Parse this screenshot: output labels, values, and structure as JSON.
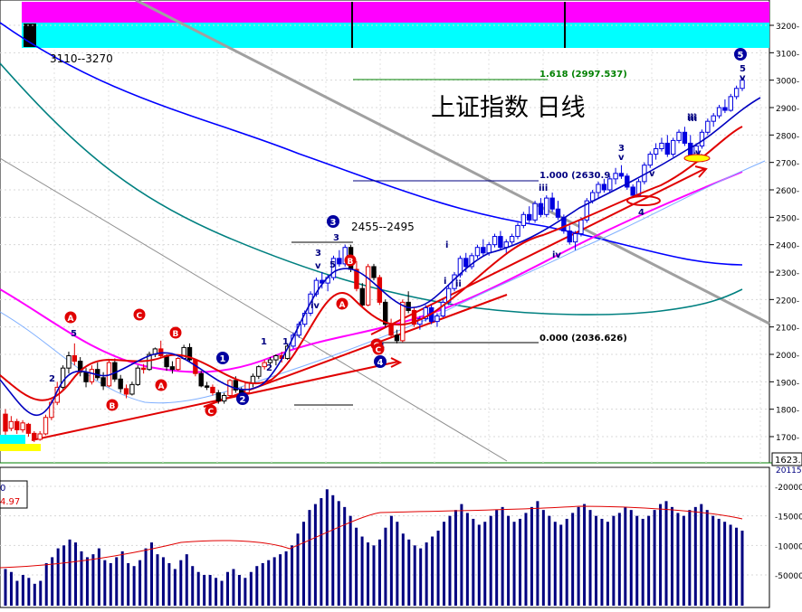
{
  "chart_data": {
    "type": "candlestick",
    "title": "上证指数  日线",
    "range_note_left": "3110--3270",
    "range_note_mid": "2455--2495",
    "fib_levels": [
      {
        "ratio": "1.618",
        "label": "1.618 (2997.537)",
        "value": 2997.537
      },
      {
        "ratio": "1.000",
        "label": "1.000 (2630.9",
        "value": 2630.9
      },
      {
        "ratio": "0.000",
        "label": "0.000 (2036.626)",
        "value": 2036.626
      }
    ],
    "y_axis": {
      "ticks": [
        "3200",
        "3100",
        "3000",
        "2900",
        "2800",
        "2700",
        "2600",
        "2500",
        "2400",
        "2300",
        "2200",
        "2100",
        "2000",
        "1900",
        "1800",
        "1700"
      ],
      "current_price_tag": "1623."
    },
    "volume_axis": {
      "ticks": [
        "200000",
        "150000",
        "100000",
        "50000"
      ],
      "top_tag": "201150"
    },
    "legend_fragments": [
      "0",
      "4.97"
    ],
    "wave_labels_black": [
      "5",
      "3",
      "1",
      "2",
      "4",
      "1",
      "2",
      "3",
      "v",
      "iv",
      "5",
      "i",
      "ii",
      "i",
      "iii",
      "v",
      "iii",
      "iv",
      "3",
      "v",
      "4",
      "iii",
      "iv",
      "v",
      "5",
      "v"
    ],
    "wave_labels_red": [
      "A",
      "B",
      "C",
      "B",
      "C",
      "A",
      "C",
      "B",
      "A",
      "C"
    ],
    "wave_labels_circled_blue": [
      "1",
      "2",
      "3",
      "4",
      "5"
    ],
    "ohlc": [
      [
        1782,
        1800,
        1700,
        1720
      ],
      [
        1730,
        1775,
        1720,
        1755
      ],
      [
        1755,
        1765,
        1710,
        1725
      ],
      [
        1725,
        1760,
        1715,
        1750
      ],
      [
        1745,
        1750,
        1700,
        1712
      ],
      [
        1712,
        1720,
        1680,
        1690
      ],
      [
        1690,
        1720,
        1685,
        1710
      ],
      [
        1710,
        1780,
        1705,
        1770
      ],
      [
        1770,
        1835,
        1760,
        1825
      ],
      [
        1825,
        1900,
        1815,
        1880
      ],
      [
        1880,
        1960,
        1870,
        1950
      ],
      [
        1950,
        2010,
        1930,
        1995
      ],
      [
        1995,
        2040,
        1960,
        1975
      ],
      [
        1975,
        1990,
        1920,
        1935
      ],
      [
        1935,
        1950,
        1880,
        1900
      ],
      [
        1900,
        1960,
        1890,
        1945
      ],
      [
        1945,
        1970,
        1905,
        1915
      ],
      [
        1915,
        1935,
        1870,
        1885
      ],
      [
        1885,
        1980,
        1880,
        1970
      ],
      [
        1970,
        1985,
        1900,
        1910
      ],
      [
        1910,
        1925,
        1860,
        1875
      ],
      [
        1875,
        1890,
        1840,
        1855
      ],
      [
        1855,
        1900,
        1850,
        1890
      ],
      [
        1890,
        1960,
        1885,
        1950
      ],
      [
        1950,
        1965,
        1930,
        1945
      ],
      [
        1945,
        2010,
        1940,
        2000
      ],
      [
        2000,
        2025,
        1990,
        2020
      ],
      [
        2020,
        2050,
        1990,
        1995
      ],
      [
        1995,
        2000,
        1940,
        1955
      ],
      [
        1955,
        1975,
        1930,
        1945
      ],
      [
        1945,
        1990,
        1940,
        1985
      ],
      [
        1985,
        2035,
        1980,
        2025
      ],
      [
        2025,
        2040,
        1970,
        1980
      ],
      [
        1980,
        1985,
        1920,
        1930
      ],
      [
        1930,
        1940,
        1880,
        1885
      ],
      [
        1885,
        1900,
        1870,
        1880
      ],
      [
        1880,
        1890,
        1850,
        1860
      ],
      [
        1860,
        1870,
        1820,
        1830
      ],
      [
        1830,
        1860,
        1820,
        1850
      ],
      [
        1850,
        1910,
        1845,
        1905
      ],
      [
        1905,
        1920,
        1860,
        1870
      ],
      [
        1870,
        1880,
        1840,
        1860
      ],
      [
        1860,
        1900,
        1850,
        1895
      ],
      [
        1895,
        1930,
        1880,
        1920
      ],
      [
        1920,
        1960,
        1910,
        1955
      ],
      [
        1955,
        1980,
        1945,
        1970
      ],
      [
        1970,
        1990,
        1950,
        1980
      ],
      [
        1980,
        2000,
        1960,
        1995
      ],
      [
        1995,
        2010,
        1970,
        1985
      ],
      [
        1985,
        2040,
        1980,
        2030
      ],
      [
        2030,
        2080,
        2020,
        2070
      ],
      [
        2070,
        2120,
        2060,
        2110
      ],
      [
        2110,
        2160,
        2100,
        2150
      ],
      [
        2150,
        2230,
        2140,
        2220
      ],
      [
        2220,
        2280,
        2210,
        2270
      ],
      [
        2270,
        2300,
        2240,
        2260
      ],
      [
        2260,
        2290,
        2230,
        2280
      ],
      [
        2280,
        2360,
        2270,
        2350
      ],
      [
        2350,
        2380,
        2320,
        2330
      ],
      [
        2330,
        2400,
        2320,
        2390
      ],
      [
        2390,
        2400,
        2300,
        2310
      ],
      [
        2310,
        2340,
        2230,
        2240
      ],
      [
        2240,
        2260,
        2170,
        2180
      ],
      [
        2180,
        2330,
        2175,
        2320
      ],
      [
        2320,
        2330,
        2270,
        2280
      ],
      [
        2280,
        2290,
        2180,
        2190
      ],
      [
        2190,
        2200,
        2100,
        2110
      ],
      [
        2110,
        2130,
        2060,
        2070
      ],
      [
        2070,
        2090,
        2040,
        2050
      ],
      [
        2050,
        2200,
        2045,
        2190
      ],
      [
        2190,
        2230,
        2150,
        2160
      ],
      [
        2160,
        2170,
        2100,
        2110
      ],
      [
        2110,
        2140,
        2090,
        2130
      ],
      [
        2130,
        2180,
        2120,
        2170
      ],
      [
        2170,
        2180,
        2110,
        2120
      ],
      [
        2120,
        2150,
        2100,
        2140
      ],
      [
        2140,
        2200,
        2135,
        2190
      ],
      [
        2190,
        2250,
        2180,
        2240
      ],
      [
        2240,
        2300,
        2230,
        2290
      ],
      [
        2290,
        2360,
        2280,
        2350
      ],
      [
        2350,
        2370,
        2300,
        2320
      ],
      [
        2320,
        2370,
        2310,
        2360
      ],
      [
        2360,
        2400,
        2350,
        2390
      ],
      [
        2390,
        2420,
        2360,
        2370
      ],
      [
        2370,
        2410,
        2360,
        2400
      ],
      [
        2400,
        2440,
        2390,
        2430
      ],
      [
        2430,
        2450,
        2380,
        2390
      ],
      [
        2390,
        2420,
        2370,
        2410
      ],
      [
        2410,
        2440,
        2400,
        2430
      ],
      [
        2430,
        2480,
        2420,
        2470
      ],
      [
        2470,
        2520,
        2460,
        2510
      ],
      [
        2510,
        2540,
        2480,
        2490
      ],
      [
        2490,
        2560,
        2480,
        2550
      ],
      [
        2550,
        2570,
        2500,
        2510
      ],
      [
        2510,
        2580,
        2500,
        2570
      ],
      [
        2570,
        2590,
        2520,
        2530
      ],
      [
        2530,
        2560,
        2490,
        2500
      ],
      [
        2500,
        2510,
        2440,
        2450
      ],
      [
        2450,
        2470,
        2400,
        2410
      ],
      [
        2410,
        2450,
        2380,
        2440
      ],
      [
        2440,
        2500,
        2430,
        2490
      ],
      [
        2490,
        2570,
        2480,
        2560
      ],
      [
        2560,
        2600,
        2550,
        2590
      ],
      [
        2590,
        2630,
        2570,
        2620
      ],
      [
        2620,
        2640,
        2590,
        2600
      ],
      [
        2600,
        2650,
        2590,
        2640
      ],
      [
        2640,
        2680,
        2620,
        2660
      ],
      [
        2660,
        2690,
        2640,
        2650
      ],
      [
        2650,
        2660,
        2600,
        2610
      ],
      [
        2610,
        2620,
        2570,
        2580
      ],
      [
        2580,
        2640,
        2575,
        2630
      ],
      [
        2630,
        2700,
        2620,
        2690
      ],
      [
        2690,
        2740,
        2680,
        2730
      ],
      [
        2730,
        2770,
        2710,
        2750
      ],
      [
        2750,
        2790,
        2740,
        2770
      ],
      [
        2770,
        2800,
        2720,
        2730
      ],
      [
        2730,
        2790,
        2720,
        2780
      ],
      [
        2780,
        2820,
        2770,
        2810
      ],
      [
        2810,
        2830,
        2760,
        2770
      ],
      [
        2770,
        2800,
        2710,
        2720
      ],
      [
        2720,
        2770,
        2710,
        2760
      ],
      [
        2760,
        2820,
        2750,
        2810
      ],
      [
        2810,
        2860,
        2800,
        2850
      ],
      [
        2850,
        2880,
        2830,
        2870
      ],
      [
        2870,
        2910,
        2860,
        2900
      ],
      [
        2900,
        2930,
        2880,
        2890
      ],
      [
        2890,
        2950,
        2885,
        2940
      ],
      [
        2940,
        2980,
        2930,
        2970
      ],
      [
        2970,
        3010,
        2960,
        3000
      ]
    ],
    "volume": [
      60,
      55,
      40,
      50,
      45,
      35,
      40,
      70,
      80,
      95,
      100,
      110,
      105,
      90,
      80,
      85,
      95,
      75,
      70,
      80,
      90,
      70,
      65,
      75,
      95,
      105,
      85,
      80,
      70,
      60,
      75,
      85,
      65,
      55,
      50,
      50,
      45,
      40,
      55,
      60,
      50,
      45,
      55,
      65,
      70,
      75,
      80,
      85,
      90,
      100,
      120,
      140,
      160,
      170,
      180,
      195,
      185,
      175,
      165,
      150,
      130,
      115,
      105,
      100,
      110,
      130,
      150,
      140,
      120,
      110,
      100,
      95,
      105,
      115,
      125,
      140,
      150,
      160,
      170,
      155,
      145,
      135,
      140,
      150,
      160,
      165,
      150,
      140,
      145,
      155,
      165,
      175,
      160,
      150,
      140,
      135,
      145,
      155,
      165,
      170,
      160,
      150,
      145,
      140,
      150,
      155,
      165,
      160,
      150,
      145,
      150,
      160,
      170,
      175,
      165,
      155,
      150,
      160,
      165,
      170,
      160,
      150,
      145,
      140,
      135,
      130,
      125
    ]
  }
}
